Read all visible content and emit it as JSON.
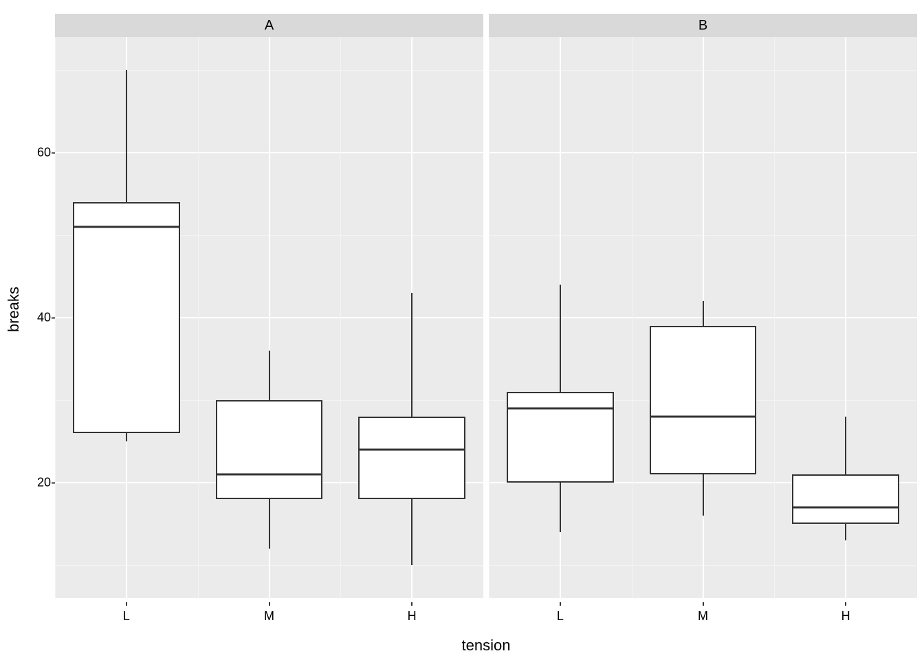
{
  "chart_data": {
    "type": "boxplot",
    "xlabel": "tension",
    "ylabel": "breaks",
    "ylim": [
      6,
      74
    ],
    "yticks": [
      20,
      40,
      60
    ],
    "categories": [
      "L",
      "M",
      "H"
    ],
    "facets": [
      {
        "name": "A",
        "boxes": [
          {
            "category": "L",
            "min": 25,
            "q1": 26,
            "median": 51,
            "q3": 54,
            "max": 70
          },
          {
            "category": "M",
            "min": 12,
            "q1": 18,
            "median": 21,
            "q3": 30,
            "max": 36
          },
          {
            "category": "H",
            "min": 10,
            "q1": 18,
            "median": 24,
            "q3": 28,
            "max": 43
          }
        ]
      },
      {
        "name": "B",
        "boxes": [
          {
            "category": "L",
            "min": 14,
            "q1": 20,
            "median": 29,
            "q3": 31,
            "max": 44
          },
          {
            "category": "M",
            "min": 16,
            "q1": 21,
            "median": 28,
            "q3": 39,
            "max": 42
          },
          {
            "category": "H",
            "min": 13,
            "q1": 15,
            "median": 17,
            "q3": 21,
            "max": 28
          }
        ]
      }
    ]
  }
}
